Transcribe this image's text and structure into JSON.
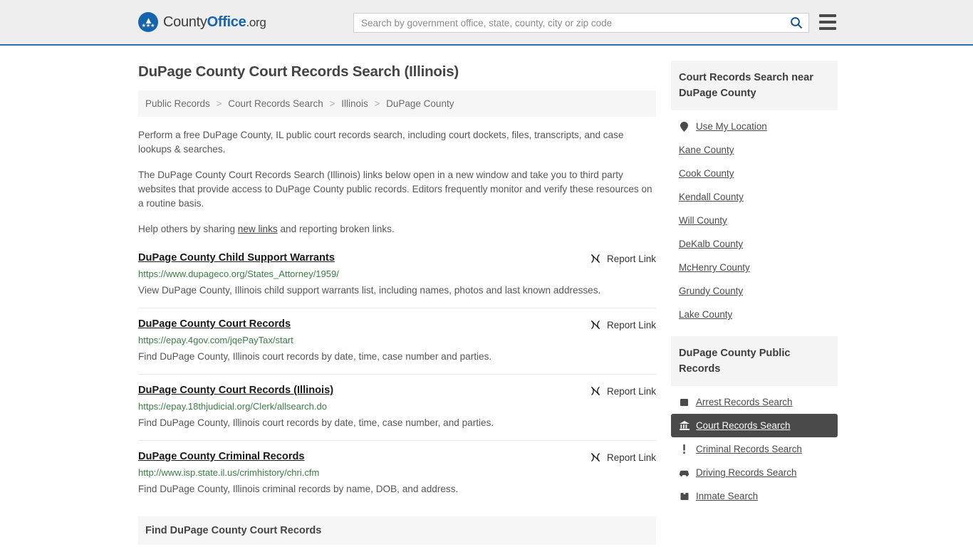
{
  "header": {
    "brand": {
      "part1": "County",
      "part2": "Office",
      "part3": ".org"
    },
    "logo_icon": "eagle-stars-icon",
    "search": {
      "placeholder": "Search by government office, state, county, city or zip code",
      "value": "",
      "icon": "search-icon"
    },
    "menu_icon": "hamburger-menu-icon",
    "accent_color": "#2f6fa8"
  },
  "main": {
    "title": "DuPage County Court Records Search (Illinois)",
    "breadcrumb": [
      "Public Records",
      "Court Records Search",
      "Illinois",
      "DuPage County"
    ],
    "breadcrumb_separator": ">",
    "paragraphs": {
      "p1": "Perform a free DuPage County, IL public court records search, including court dockets, files, transcripts, and case lookups & searches.",
      "p2": "The DuPage County Court Records Search (Illinois) links below open in a new window and take you to third party websites that provide access to DuPage County public records. Editors frequently monitor and verify these resources on a routine basis.",
      "p3_before": "Help others by sharing ",
      "p3_link": "new links",
      "p3_after": " and reporting broken links."
    },
    "report_link_label": "Report Link",
    "report_link_icon": "broken-link-icon",
    "results": [
      {
        "title": "DuPage County Child Support Warrants",
        "url": "https://www.dupageco.org/States_Attorney/1959/",
        "description": "View DuPage County, Illinois child support warrants list, including names, photos and last known addresses."
      },
      {
        "title": "DuPage County Court Records",
        "url": "https://epay.4gov.com/jqePayTax/start",
        "description": "Find DuPage County, Illinois court records by date, time, case number and parties."
      },
      {
        "title": "DuPage County Court Records (Illinois)",
        "url": "https://epay.18thjudicial.org/Clerk/allsearch.do",
        "description": "Find DuPage County, Illinois court records by date, time, case number, and parties."
      },
      {
        "title": "DuPage County Criminal Records",
        "url": "http://www.isp.state.il.us/crimhistory/chri.cfm",
        "description": "Find DuPage County, Illinois criminal records by name, DOB, and address."
      }
    ],
    "section_heading": "Find DuPage County Court Records"
  },
  "sidebar": {
    "nearby": {
      "heading": "Court Records Search near DuPage County",
      "use_my_location": {
        "label": "Use My Location",
        "icon": "map-pin-icon"
      },
      "counties": [
        "Kane County",
        "Cook County",
        "Kendall County",
        "Will County",
        "DeKalb County",
        "McHenry County",
        "Grundy County",
        "Lake County"
      ]
    },
    "public_records": {
      "heading": "DuPage County Public Records",
      "items": [
        {
          "label": "Arrest Records Search",
          "icon": "fingerprint-icon",
          "active": false
        },
        {
          "label": "Court Records Search",
          "icon": "courthouse-icon",
          "active": true
        },
        {
          "label": "Criminal Records Search",
          "icon": "exclamation-icon",
          "active": false
        },
        {
          "label": "Driving Records Search",
          "icon": "car-icon",
          "active": false
        },
        {
          "label": "Inmate Search",
          "icon": "jail-icon",
          "active": false
        }
      ]
    }
  }
}
